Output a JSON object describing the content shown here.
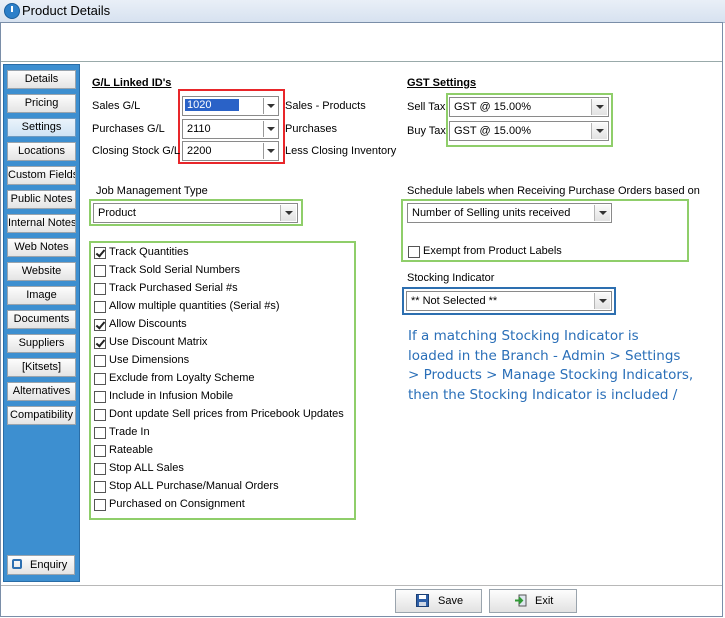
{
  "window": {
    "title": "Product Details"
  },
  "sidebar": {
    "items": [
      {
        "label": "Details"
      },
      {
        "label": "Pricing"
      },
      {
        "label": "Settings"
      },
      {
        "label": "Locations"
      },
      {
        "label": "Custom Fields"
      },
      {
        "label": "Public Notes"
      },
      {
        "label": "Internal Notes"
      },
      {
        "label": "Web Notes"
      },
      {
        "label": "Website"
      },
      {
        "label": "Image"
      },
      {
        "label": "Documents"
      },
      {
        "label": "Suppliers"
      },
      {
        "label": "[Kitsets]"
      },
      {
        "label": "Alternatives"
      },
      {
        "label": "Compatibility"
      }
    ],
    "active": "Settings",
    "enquiry_label": "Enquiry"
  },
  "gl": {
    "header": "G/L Linked ID's",
    "rows": [
      {
        "label": "Sales G/L",
        "value": "1020",
        "desc": "Sales - Products"
      },
      {
        "label": "Purchases G/L",
        "value": "2110",
        "desc": "Purchases"
      },
      {
        "label": "Closing Stock G/L",
        "value": "2200",
        "desc": "Less Closing Inventory"
      }
    ]
  },
  "gst": {
    "header": "GST Settings",
    "sell_tax_label": "Sell Tax",
    "sell_tax_value": "GST @ 15.00%",
    "buy_tax_label": "Buy Tax",
    "buy_tax_value": "GST @ 15.00%"
  },
  "job": {
    "label": "Job Management Type",
    "value": "Product"
  },
  "schedule": {
    "label": "Schedule labels when Receiving Purchase Orders based on",
    "value": "Number of Selling units received",
    "exempt_label": "Exempt from Product Labels",
    "exempt_checked": false
  },
  "stocking": {
    "label": "Stocking Indicator",
    "value": "** Not Selected **"
  },
  "checkboxes": [
    {
      "label": "Track Quantities",
      "checked": true
    },
    {
      "label": "Track Sold Serial Numbers",
      "checked": false
    },
    {
      "label": "Track Purchased Serial #s",
      "checked": false
    },
    {
      "label": "Allow multiple quantities (Serial #s)",
      "checked": false
    },
    {
      "label": "Allow Discounts",
      "checked": true
    },
    {
      "label": "Use Discount Matrix",
      "checked": true
    },
    {
      "label": "Use Dimensions",
      "checked": false
    },
    {
      "label": "Exclude from Loyalty Scheme",
      "checked": false
    },
    {
      "label": "Include in Infusion Mobile",
      "checked": false
    },
    {
      "label": "Dont update Sell prices from Pricebook Updates",
      "checked": false
    },
    {
      "label": "Trade In",
      "checked": false
    },
    {
      "label": "Rateable",
      "checked": false
    },
    {
      "label": "Stop ALL Sales",
      "checked": false
    },
    {
      "label": "Stop ALL Purchase/Manual Orders",
      "checked": false
    },
    {
      "label": "Purchased on Consignment",
      "checked": false
    }
  ],
  "note": {
    "lines": [
      "If a matching Stocking Indicator is",
      "loaded in the Branch -  Admin > Settings",
      "> Products > Manage Stocking Indicators,",
      "then the Stocking Indicator is included /"
    ]
  },
  "footer": {
    "save_label": "Save",
    "exit_label": "Exit"
  },
  "colors": {
    "sidebar": "#3d8fd0",
    "highlight_green": "#8fce6a",
    "highlight_red": "#e8262a",
    "highlight_blue": "#2d6fb0",
    "note_text": "#2a6fb8"
  }
}
